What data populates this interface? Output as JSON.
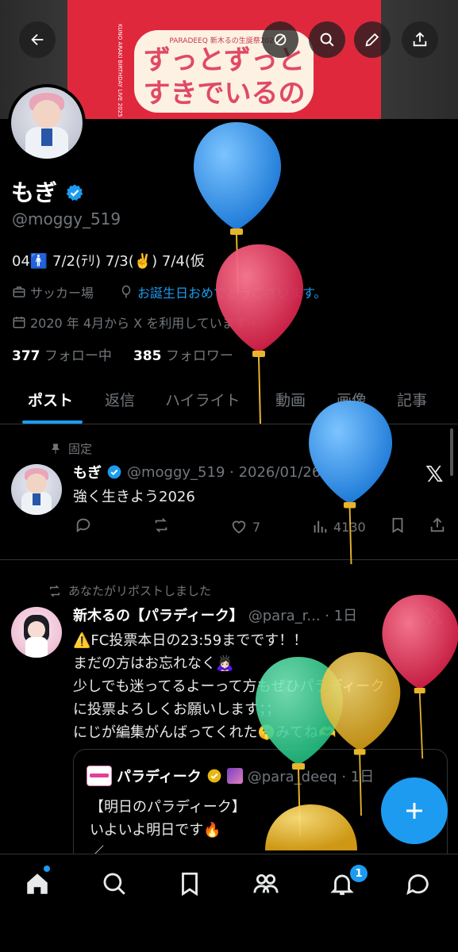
{
  "header": {
    "poster": {
      "subtitle": "PARADEEQ 新木るの生誕祭2025",
      "line1": "ずっとずっと",
      "line2": "すきでいるの",
      "side_text": "KUNO ARAKI BIRTHDAY LIVE 2025"
    },
    "buttons": [
      "back",
      "mute",
      "search",
      "edit",
      "share"
    ]
  },
  "profile": {
    "name": "もぎ",
    "handle": "@moggy_519",
    "bio": "04🚹 7/2(ﾃﾘ) 7/3(✌️) 7/4(仮",
    "location": "サッカー場",
    "link_text": "お誕生日おめでとうございます。",
    "joined": "2020 年 4月から X を利用しています",
    "following_count": "377",
    "following_label": "フォロー中",
    "followers_count": "385",
    "followers_label": "フォロワー"
  },
  "tabs": [
    "ポスト",
    "返信",
    "ハイライト",
    "動画",
    "画像",
    "記事"
  ],
  "pinned_post": {
    "pinned_label": "固定",
    "name": "もぎ",
    "handle_time": "@moggy_519 · 2026/01/26",
    "text": "強く生きよう2026",
    "likes": "7",
    "views": "4130"
  },
  "repost": {
    "repost_label": "あなたがリポストしました",
    "name": "新木るの【パラディーク】",
    "handle_time": "@para_r... · 1日",
    "lines": [
      "⚠️FC投票本日の23:59までです！！",
      "まだの方はお忘れなく🙇🏻‍♀️",
      "少しでも迷ってるよーって方もぜひパラディーク",
      "に投票よろしくお願いします；；",
      "にじが編集がんばってくれた🤫みてね🫶"
    ]
  },
  "quote": {
    "name": "パラディーク",
    "handle_time": "@para_deeq · 1日",
    "lines": [
      "【明日のパラディーク】",
      "いよいよ明日です🔥",
      "／"
    ]
  },
  "nav": {
    "items": [
      "home",
      "search",
      "bookmarks",
      "communities",
      "notifications",
      "messages"
    ],
    "notification_badge": "1"
  },
  "colors": {
    "accent": "#1d9bf0",
    "balloon_blue": "#2f8fe0",
    "balloon_red": "#e0304f",
    "balloon_green": "#2fd191",
    "balloon_yellow": "#e7b52a"
  }
}
